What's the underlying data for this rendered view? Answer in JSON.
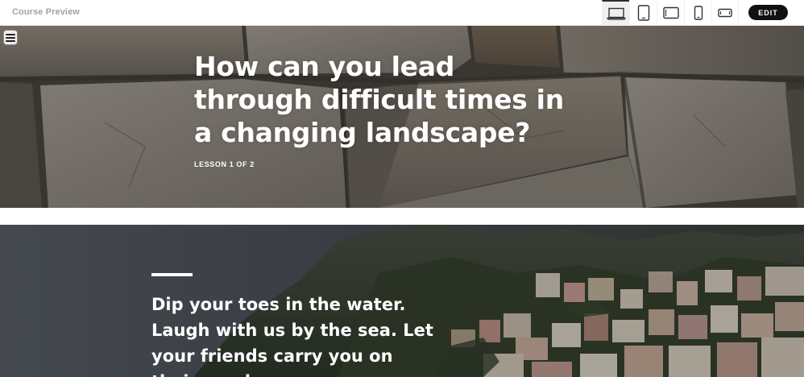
{
  "header": {
    "title": "Course Preview",
    "edit_label": "EDIT",
    "devices": [
      {
        "icon": "laptop-icon",
        "active": true
      },
      {
        "icon": "tablet-portrait-icon",
        "active": false
      },
      {
        "icon": "tablet-landscape-icon",
        "active": false
      },
      {
        "icon": "phone-portrait-icon",
        "active": false
      },
      {
        "icon": "phone-landscape-icon",
        "active": false
      }
    ]
  },
  "hero": {
    "title": "How can you lead through difficult times in a changing landscape?",
    "lesson_label": "LESSON 1 OF 2",
    "menu_icon": "hamburger-menu-icon"
  },
  "section2": {
    "quote": "Dip your toes in the water. Laugh with us by the sea. Let your friends carry you on their good"
  },
  "colors": {
    "edit_button_bg": "#111111",
    "title_text": "#ffffff",
    "app_title": "#a2a2a2"
  }
}
